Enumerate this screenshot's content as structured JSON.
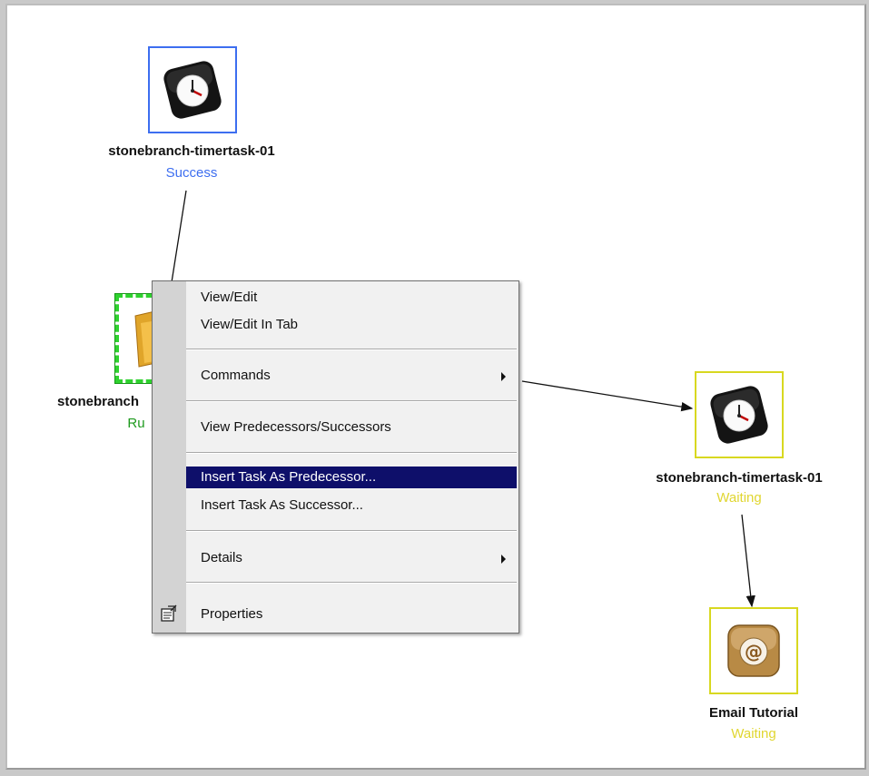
{
  "workflow": {
    "nodes": [
      {
        "name": "stonebranch-timertask-01",
        "status": "Success",
        "icon": "timer-clock-icon"
      },
      {
        "name": "stonebranch",
        "status": "Ru",
        "icon": "file-transfer-icon"
      },
      {
        "name": "stonebranch-timertask-01",
        "status": "Waiting",
        "icon": "timer-clock-icon"
      },
      {
        "name": "Email Tutorial",
        "status": "Waiting",
        "icon": "email-at-icon"
      }
    ],
    "colors": {
      "success": "#3d6ef0",
      "waiting": "#e0d630",
      "running": "#1e9a1e",
      "menu_highlight": "#0e0f6a"
    }
  },
  "context_menu": {
    "items": [
      {
        "label": "View/Edit"
      },
      {
        "label": "View/Edit In Tab"
      },
      {
        "label": "Commands"
      },
      {
        "label": "View Predecessors/Successors"
      },
      {
        "label": "Insert Task As Predecessor..."
      },
      {
        "label": "Insert Task As Successor..."
      },
      {
        "label": "Details"
      },
      {
        "label": "Properties",
        "icon": "properties-icon"
      }
    ],
    "highlighted": "Insert Task As Predecessor..."
  }
}
